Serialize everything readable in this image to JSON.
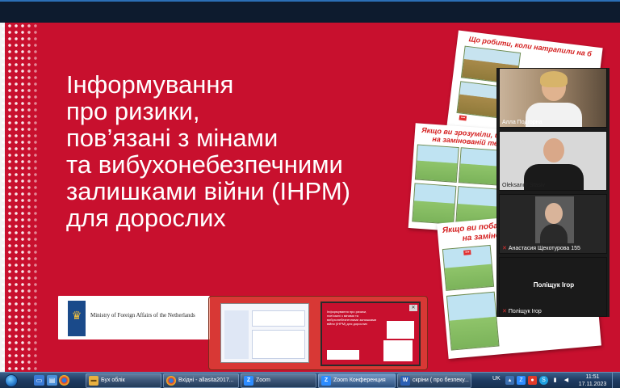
{
  "slide": {
    "title_lines": [
      "Інформування",
      "про ризики,",
      "пов’язані з мінами",
      "та вибухонебезпечними",
      "залишками війни (ІНРМ)",
      "для дорослих"
    ],
    "logo_text": "Ministry of Foreign Affairs of the Netherlands",
    "poster1_heading": "Що робити, коли натрапили на б",
    "poster2_heading_1": "Якщо ви зрозуміли, що опи",
    "poster2_heading_2": "на замінованій території",
    "poster3_heading_1": "Якщо ви побачили",
    "poster3_heading_2": "на замінованій т"
  },
  "participants": [
    {
      "name": "Алла Подгорна",
      "muted": false
    },
    {
      "name": "Oleksandr Stasiv",
      "muted": false
    },
    {
      "name": "Анастасия Щекотурова 155",
      "muted": true
    },
    {
      "name": "Поліщук Ігор",
      "display_name": "Поліщук Ігор",
      "muted": true
    }
  ],
  "preview": {
    "mini_title": "Інформування про ризики, пов’язані з мінами та вибухонебезпечними залишками війни (ІНРМ) для дорослих"
  },
  "taskbar": {
    "buttons": [
      {
        "label": "Бух облік",
        "icon": "folder-icon",
        "color": "#e8b040"
      },
      {
        "label": "Вхідні - allasita2017...",
        "icon": "chrome-icon",
        "color": "#2e9a40"
      },
      {
        "label": "Zoom",
        "icon": "zoom-icon",
        "color": "#2d8cff"
      },
      {
        "label": "Zoom Конференция",
        "icon": "zoom-icon",
        "color": "#2d8cff"
      },
      {
        "label": "скріни ( про безпеку...",
        "icon": "word-icon",
        "color": "#2b5fb4"
      }
    ],
    "language": "UK",
    "time": "11:51",
    "date": "17.11.2023"
  }
}
